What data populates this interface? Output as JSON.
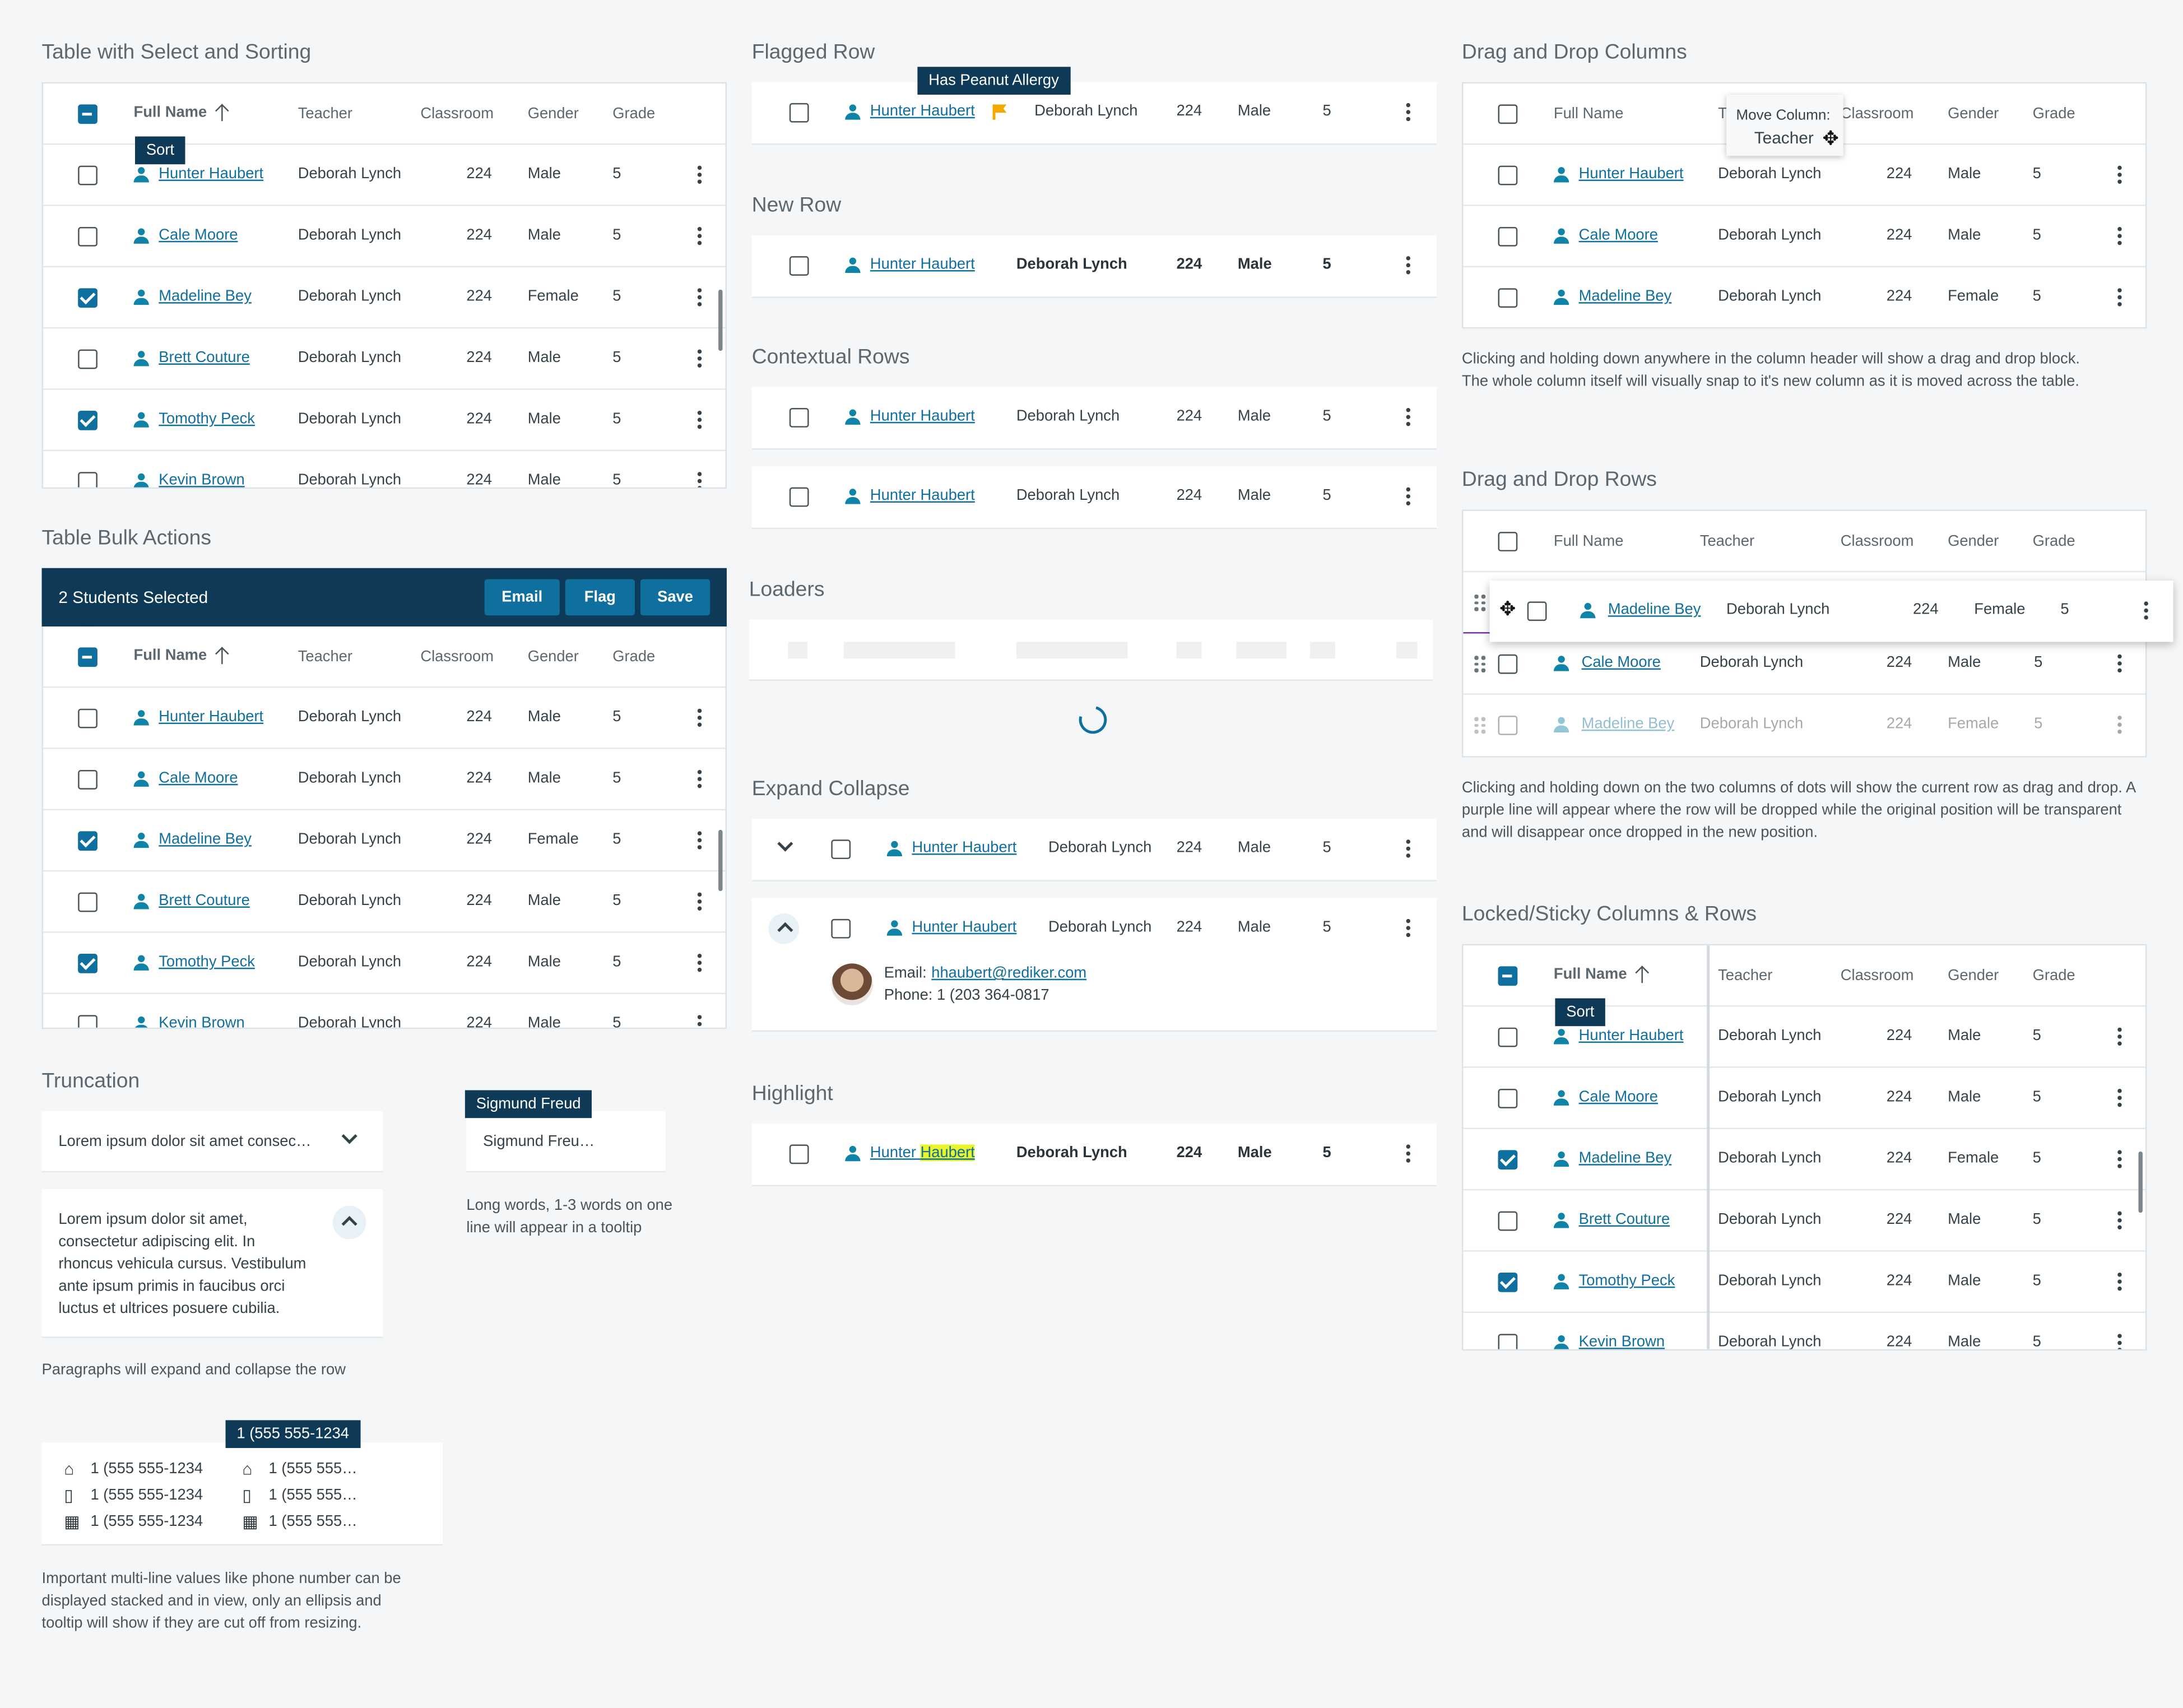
{
  "sections": {
    "table_select": "Table with Select and Sorting",
    "bulk": "Table Bulk Actions",
    "truncation": "Truncation",
    "flagged": "Flagged Row",
    "new_row": "New Row",
    "contextual": "Contextual Rows",
    "loaders": "Loaders",
    "expand": "Expand Collapse",
    "highlight": "Highlight",
    "dnd_cols": "Drag and Drop Columns",
    "dnd_rows": "Drag and Drop Rows",
    "locked": "Locked/Sticky Columns & Rows"
  },
  "headers": {
    "full_name": "Full Name",
    "teacher": "Teacher",
    "classroom": "Classroom",
    "gender": "Gender",
    "grade": "Grade"
  },
  "rows": [
    {
      "name": "Hunter Haubert",
      "teacher": "Deborah Lynch",
      "room": "224",
      "gender": "Male",
      "grade": "5"
    },
    {
      "name": "Cale Moore",
      "teacher": "Deborah Lynch",
      "room": "224",
      "gender": "Male",
      "grade": "5"
    },
    {
      "name": "Madeline Bey",
      "teacher": "Deborah Lynch",
      "room": "224",
      "gender": "Female",
      "grade": "5"
    },
    {
      "name": "Brett Couture",
      "teacher": "Deborah Lynch",
      "room": "224",
      "gender": "Male",
      "grade": "5"
    },
    {
      "name": "Tomothy Peck",
      "teacher": "Deborah Lynch",
      "room": "224",
      "gender": "Male",
      "grade": "5"
    },
    {
      "name": "Kevin Brown",
      "teacher": "Deborah Lynch",
      "room": "224",
      "gender": "Male",
      "grade": "5"
    }
  ],
  "checked": [
    false,
    false,
    true,
    false,
    true,
    false
  ],
  "tooltips": {
    "sort": "Sort",
    "peanut": "Has Peanut Allergy",
    "move_column": "Move Column:",
    "move_column_name": "Teacher",
    "sigmund": "Sigmund Freud",
    "phone": "1 (555 555-1234"
  },
  "bulk": {
    "selected": "2 Students Selected",
    "email": "Email",
    "flag": "Flag",
    "save": "Save"
  },
  "highlight": {
    "first": "Hunter ",
    "match": "Haubert"
  },
  "expand": {
    "email_label": "Email:",
    "email": "hhaubert@rediker.com",
    "phone": "Phone: 1 (203 364-0817"
  },
  "truncation": {
    "short": "Lorem ipsum dolor sit amet consec…",
    "long": "Lorem ipsum dolor sit amet, consectetur adipiscing elit. In rhoncus vehicula cursus. Vestibulum ante ipsum primis in faucibus orci luctus et ultrices posuere cubilia.",
    "note_para": "Paragraphs will expand and collapse the row",
    "sigmund_trunc": "Sigmund Freu…",
    "note_tooltip": "Long words, 1-3 words on one line will appear in a tooltip",
    "phone_full": "1 (555 555-1234",
    "phone_trunc": "1 (555 555…",
    "note_phone": "Important multi-line values like phone number can be displayed stacked and in view, only an ellipsis and tooltip will show if they are cut off from resizing."
  },
  "notes": {
    "dnd_cols": "Clicking and holding down anywhere in the column header will show a drag and drop block. The whole column itself will visually snap to it's new column as it is moved across the table.",
    "dnd_rows": "Clicking and holding down on the two columns of dots will show the current row as drag and drop. A purple line will appear where the row will be dropped while the original position will be transparent and will disappear once dropped in the new position."
  },
  "icons": [
    "person-icon",
    "kebab-icon",
    "flag-icon",
    "chevron-down-icon",
    "chevron-up-icon",
    "sort-arrow-icon",
    "drag-handle-icon",
    "move-icon",
    "home-icon",
    "mobile-icon",
    "building-icon",
    "spinner-icon",
    "avatar"
  ],
  "colors": {
    "accent": "#0f6f9e",
    "banner": "#0e3a57",
    "flag": "#f2a900",
    "highlight": "#e8f52a",
    "drop_line": "#7a2ea8"
  }
}
